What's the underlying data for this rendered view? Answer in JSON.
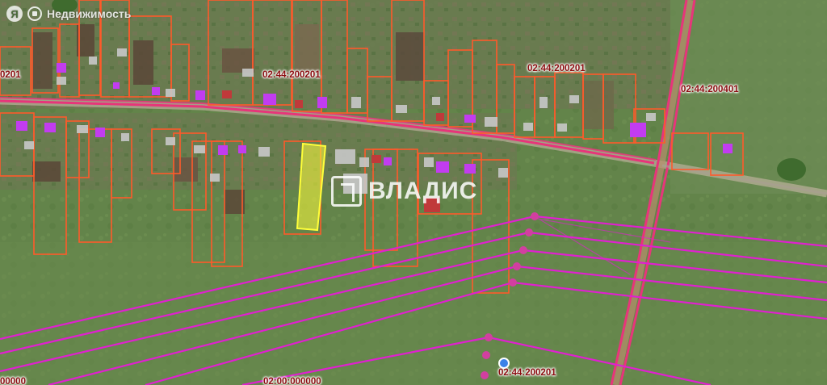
{
  "header": {
    "brand_letter": "Я",
    "brand_label": "Недвижимость"
  },
  "watermark": {
    "text": "ВЛАДИС"
  },
  "cadastral_labels": [
    {
      "id": "label-1",
      "text": "0201"
    },
    {
      "id": "label-2",
      "text": "02:44:200201"
    },
    {
      "id": "label-3",
      "text": "02:44:200201"
    },
    {
      "id": "label-4",
      "text": "02:44:200401"
    },
    {
      "id": "label-5",
      "text": "02:44:200201"
    },
    {
      "id": "label-6",
      "text": "00000"
    },
    {
      "id": "label-7",
      "text": "02:00:000000"
    }
  ],
  "colors": {
    "parcel_border": "#ff5a2a",
    "selected_parcel": "#ffff3a",
    "power_lines": "#e020d0",
    "roads": "#e7357a",
    "roof_purple": "#c23cf0",
    "label_text": "#8b0d10",
    "pin": "#3b82e8"
  },
  "icons": [
    "map-pin-icon",
    "logo-icon",
    "watermark-logo-icon"
  ]
}
